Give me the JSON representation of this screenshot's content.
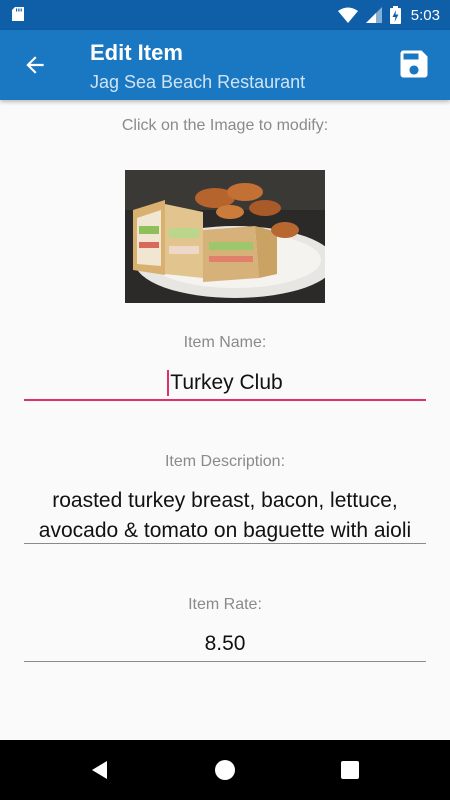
{
  "status_bar": {
    "time": "5:03",
    "icons": [
      "sd-card-icon",
      "wifi-icon",
      "cell-signal-icon",
      "battery-charging-icon"
    ]
  },
  "app_bar": {
    "title": "Edit Item",
    "subtitle": "Jag Sea Beach Restaurant",
    "back_icon": "arrow-back-icon",
    "save_icon": "save-icon",
    "color": "#1a78c2"
  },
  "form": {
    "image_hint": "Click on the Image to modify:",
    "name_label": "Item Name:",
    "name_value": "Turkey Club",
    "description_label": "Item Description:",
    "description_line1": "roasted turkey breast, bacon, lettuce,",
    "description_line2": "avocado & tomato on baguette with aioli",
    "rate_label": "Item Rate:",
    "rate_value": "8.50",
    "focus_color": "#e0306c"
  },
  "nav_bar": {
    "icons": [
      "nav-back-icon",
      "nav-home-icon",
      "nav-recents-icon"
    ]
  }
}
